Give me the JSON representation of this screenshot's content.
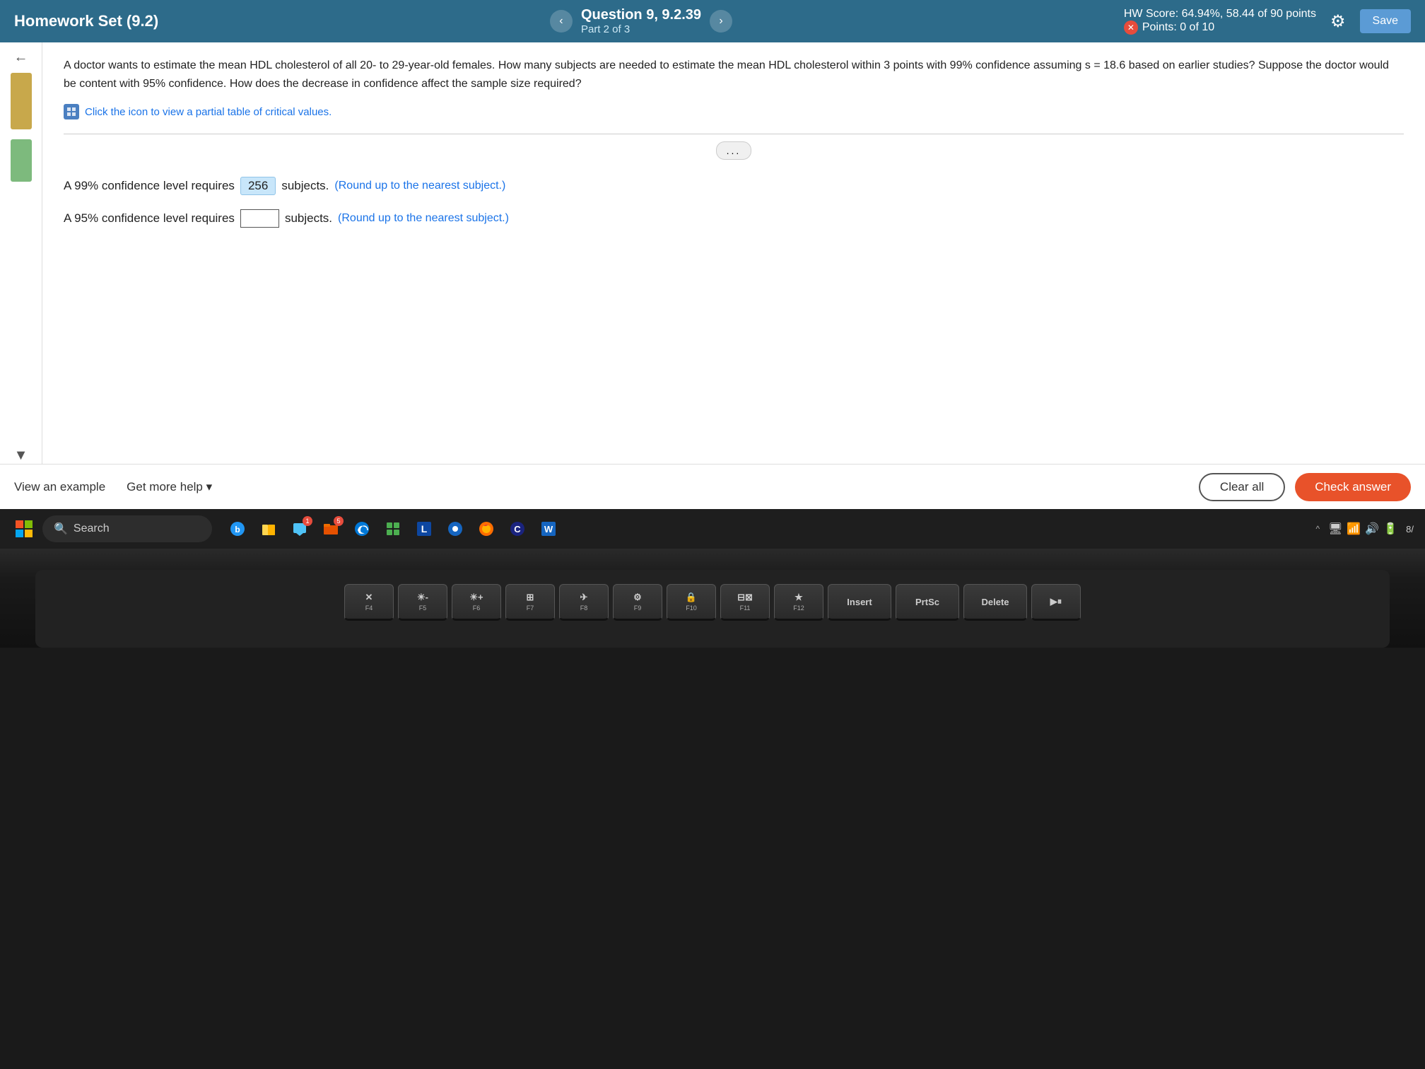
{
  "header": {
    "homework_label": "Homework Set (9.2)",
    "question_title": "Question 9, 9.2.39",
    "part_label": "Part 2 of 3",
    "hw_score": "HW Score: 64.94%, 58.44 of 90 points",
    "points": "Points: 0 of 10",
    "save_label": "Save",
    "nav_prev": "‹",
    "nav_next": "›"
  },
  "question": {
    "text": "A doctor wants to estimate the mean HDL cholesterol of all 20- to 29-year-old females. How many subjects are needed to estimate the mean HDL cholesterol within 3 points with 99% confidence assuming s = 18.6 based on earlier studies? Suppose the doctor would be content with 95% confidence. How does the decrease in confidence affect the sample size required?",
    "click_icon_text": "Click the icon to view a partial table of critical values.",
    "dots": "...",
    "answer_99_prefix": "A 99% confidence level requires",
    "answer_99_value": "256",
    "answer_99_suffix": "subjects. (Round up to the nearest subject.)",
    "answer_99_blue": "(Round up to the nearest subject.)",
    "answer_95_prefix": "A 95% confidence level requires",
    "answer_95_value": "",
    "answer_95_suffix": "subjects. (Round up to the nearest subject.)",
    "answer_95_blue": "(Round up to the nearest subject.)"
  },
  "footer": {
    "view_example": "View an example",
    "get_more_help": "Get more help ▾",
    "clear_all": "Clear all",
    "check_answer": "Check answer"
  },
  "taskbar": {
    "search_placeholder": "Search",
    "time": "8/"
  },
  "keyboard": {
    "row1": [
      {
        "main": "✕",
        "sub": "F4"
      },
      {
        "main": "☀-",
        "sub": "F5"
      },
      {
        "main": "☀+",
        "sub": "F6"
      },
      {
        "main": "⊟⊞",
        "sub": "F7"
      },
      {
        "main": "✈",
        "sub": "F8"
      },
      {
        "main": "⚙",
        "sub": "F9"
      },
      {
        "main": "🔒",
        "sub": "F10"
      },
      {
        "main": "☰☰☰",
        "sub": "F11"
      },
      {
        "main": "★",
        "sub": "F12"
      },
      {
        "main": "Insert",
        "sub": ""
      },
      {
        "main": "PrtSc",
        "sub": ""
      },
      {
        "main": "Delete",
        "sub": ""
      },
      {
        "main": "▶⏸",
        "sub": ""
      }
    ]
  }
}
